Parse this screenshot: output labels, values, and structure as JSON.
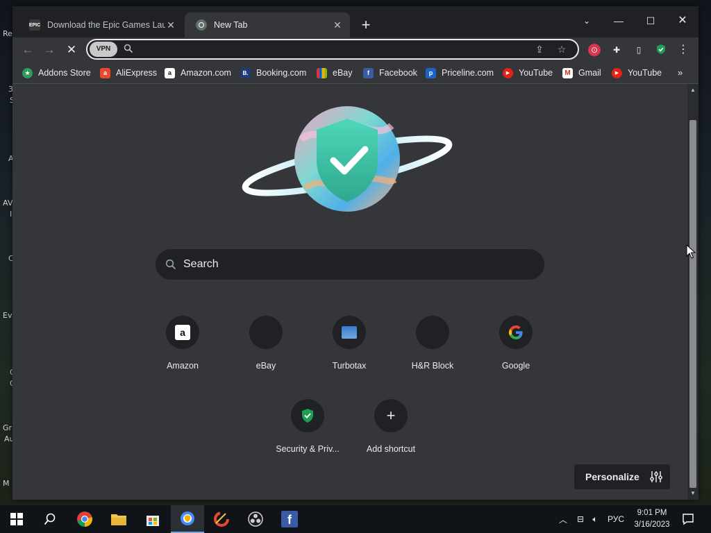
{
  "desktop": {
    "labels": [
      "Re",
      "3",
      "S",
      "A",
      "AV",
      "I",
      "C",
      "Ev",
      "C",
      "C",
      "Gr",
      "Au",
      "M"
    ]
  },
  "browser": {
    "tabs": [
      {
        "title": "Download the Epic Games Launc",
        "favicon": "epic-games-icon",
        "favicon_text": "EPIC",
        "active": false
      },
      {
        "title": "New Tab",
        "favicon": "vpn-shield-icon",
        "active": true
      }
    ],
    "omnibox": {
      "vpn_badge": "VPN",
      "value": "",
      "placeholder": ""
    },
    "bookmarks": [
      {
        "label": "Addons Store",
        "icon": "addons-store-icon",
        "color": "#2e9c5a",
        "glyph": "★"
      },
      {
        "label": "AliExpress",
        "icon": "aliexpress-icon",
        "color": "#e8492c",
        "glyph": "a"
      },
      {
        "label": "Amazon.com",
        "icon": "amazon-icon",
        "color": "#ffffff",
        "glyph": "a"
      },
      {
        "label": "Booking.com",
        "icon": "booking-icon",
        "color": "#1e3c7a",
        "glyph": "B."
      },
      {
        "label": "eBay",
        "icon": "ebay-icon",
        "color": "#202124",
        "glyph": "e"
      },
      {
        "label": "Facebook",
        "icon": "facebook-icon",
        "color": "#3b5aa6",
        "glyph": "f"
      },
      {
        "label": "Priceline.com",
        "icon": "priceline-icon",
        "color": "#1d62c9",
        "glyph": "p"
      },
      {
        "label": "YouTube",
        "icon": "youtube-icon",
        "color": "#e62117",
        "glyph": "▶"
      },
      {
        "label": "Gmail",
        "icon": "gmail-icon",
        "color": "#ffffff",
        "glyph": "M"
      },
      {
        "label": "YouTube",
        "icon": "youtube-icon",
        "color": "#e62117",
        "glyph": "▶"
      }
    ]
  },
  "newtab": {
    "search_label": "Search",
    "shortcuts": [
      {
        "label": "Amazon",
        "icon": "amazon-icon"
      },
      {
        "label": "eBay",
        "icon": "ebay-icon"
      },
      {
        "label": "Turbotax",
        "icon": "turbotax-icon"
      },
      {
        "label": "H&R Block",
        "icon": "hr-block-icon"
      },
      {
        "label": "Google",
        "icon": "google-icon"
      },
      {
        "label": "Security & Priv...",
        "icon": "security-shield-icon"
      },
      {
        "label": "Add shortcut",
        "icon": "plus-icon"
      }
    ],
    "personalize_label": "Personalize"
  },
  "taskbar": {
    "language": "РУС",
    "time": "9:01 PM",
    "date": "3/16/2023"
  }
}
